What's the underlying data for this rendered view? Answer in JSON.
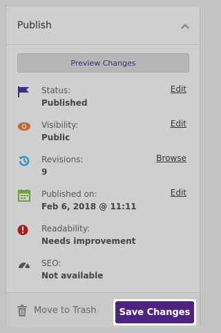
{
  "panel": {
    "title": "Publish",
    "preview_label": "Preview Changes"
  },
  "rows": [
    {
      "icon": "flag-icon",
      "label": "Status:",
      "value": "Published",
      "link": "Edit"
    },
    {
      "icon": "eye-icon",
      "label": "Visibility:",
      "value": "Public",
      "link": "Edit"
    },
    {
      "icon": "history-icon",
      "label": "Revisions:",
      "value": "9",
      "link": "Browse"
    },
    {
      "icon": "calendar-icon",
      "label": "Published on:",
      "value": "Feb 6, 2018 @ 11:11",
      "link": "Edit"
    },
    {
      "icon": "alert-icon",
      "label": "Readability:",
      "value": "Needs improvement",
      "link": ""
    },
    {
      "icon": "gauge-icon",
      "label": "SEO:",
      "value": "Not available",
      "link": ""
    }
  ],
  "footer": {
    "trash_label": "Move to Trash",
    "save_label": "Save Changes"
  },
  "colors": {
    "accent": "#4d2380",
    "flag": "#3d2d7a",
    "eye": "#c0642a",
    "history": "#2f8fbf",
    "calendar": "#6fa03a",
    "alert": "#b01c1c",
    "gauge": "#555555"
  }
}
